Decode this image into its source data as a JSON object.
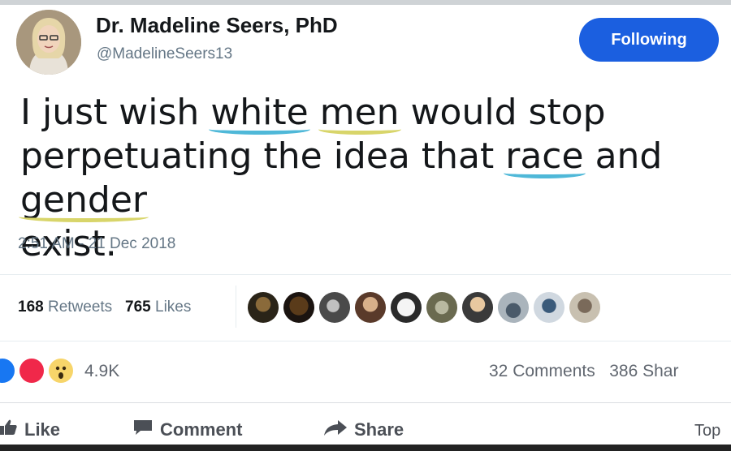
{
  "author": {
    "name": "Dr. Madeline Seers, PhD",
    "handle": "@MadelineSeers13"
  },
  "follow_button": {
    "label": "Following"
  },
  "tweet": {
    "words": [
      "I",
      "just",
      "wish",
      "white",
      "men",
      "would",
      "stop",
      "perpetuating",
      "the",
      "idea",
      "that",
      "race",
      "and",
      "gender",
      "exist."
    ],
    "timestamp": "2:51 AM - 21 Dec 2018"
  },
  "stats": {
    "retweets_count": "168",
    "retweets_label": "Retweets",
    "likes_count": "765",
    "likes_label": "Likes"
  },
  "reactions": {
    "count": "4.9K",
    "icons": [
      "like-reaction-icon",
      "love-reaction-icon",
      "wow-reaction-icon"
    ]
  },
  "comments_shares": {
    "comments": "32 Comments",
    "shares": "386 Shar"
  },
  "actions": {
    "like": "Like",
    "comment": "Comment",
    "share": "Share",
    "top": "Top"
  },
  "colors": {
    "follow_button": "#1b5fe0",
    "underline_blue": "#4fb8d8",
    "underline_yellow": "#d8d56a",
    "like_reaction": "#1877f2",
    "love_reaction": "#f0284a",
    "wow_reaction": "#f7d56a"
  }
}
